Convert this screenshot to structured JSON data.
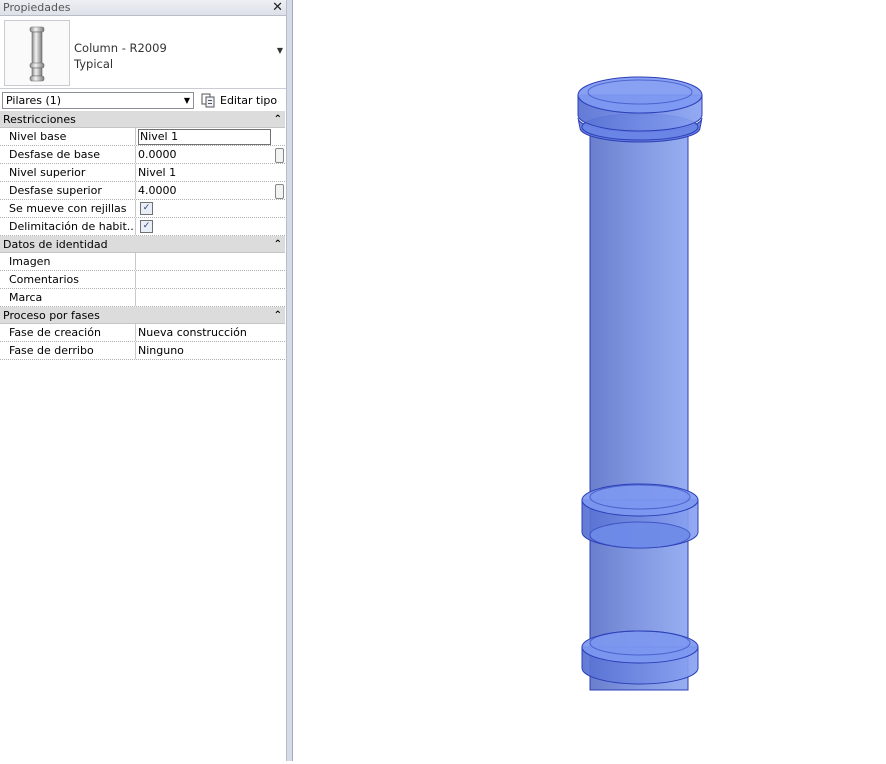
{
  "panel": {
    "title": "Propiedades",
    "close_icon": "close-icon",
    "type": {
      "family": "Column - R2009",
      "name": "Typical"
    },
    "filter": "Pilares (1)",
    "edit_type_label": "Editar tipo"
  },
  "categories": [
    {
      "name": "Restricciones",
      "rows": [
        {
          "key": "Nivel base",
          "value": "Nivel 1"
        },
        {
          "key": "Desfase de base",
          "value": "0.0000"
        },
        {
          "key": "Nivel superior",
          "value": "Nivel 1"
        },
        {
          "key": "Desfase superior",
          "value": "4.0000"
        },
        {
          "key": "Se mueve con rejillas",
          "checked": true
        },
        {
          "key": "Delimitación de habit...",
          "checked": true
        }
      ]
    },
    {
      "name": "Datos de identidad",
      "rows": [
        {
          "key": "Imagen",
          "value": ""
        },
        {
          "key": "Comentarios",
          "value": ""
        },
        {
          "key": "Marca",
          "value": ""
        }
      ]
    },
    {
      "name": "Proceso por fases",
      "rows": [
        {
          "key": "Fase de creación",
          "value": "Nueva construcción"
        },
        {
          "key": "Fase de derribo",
          "value": "Ninguno"
        }
      ]
    }
  ],
  "colors": {
    "column_fill": "#6f8fe6",
    "column_stroke": "#2c3fb8",
    "category_bg": "#dcdcdc"
  }
}
